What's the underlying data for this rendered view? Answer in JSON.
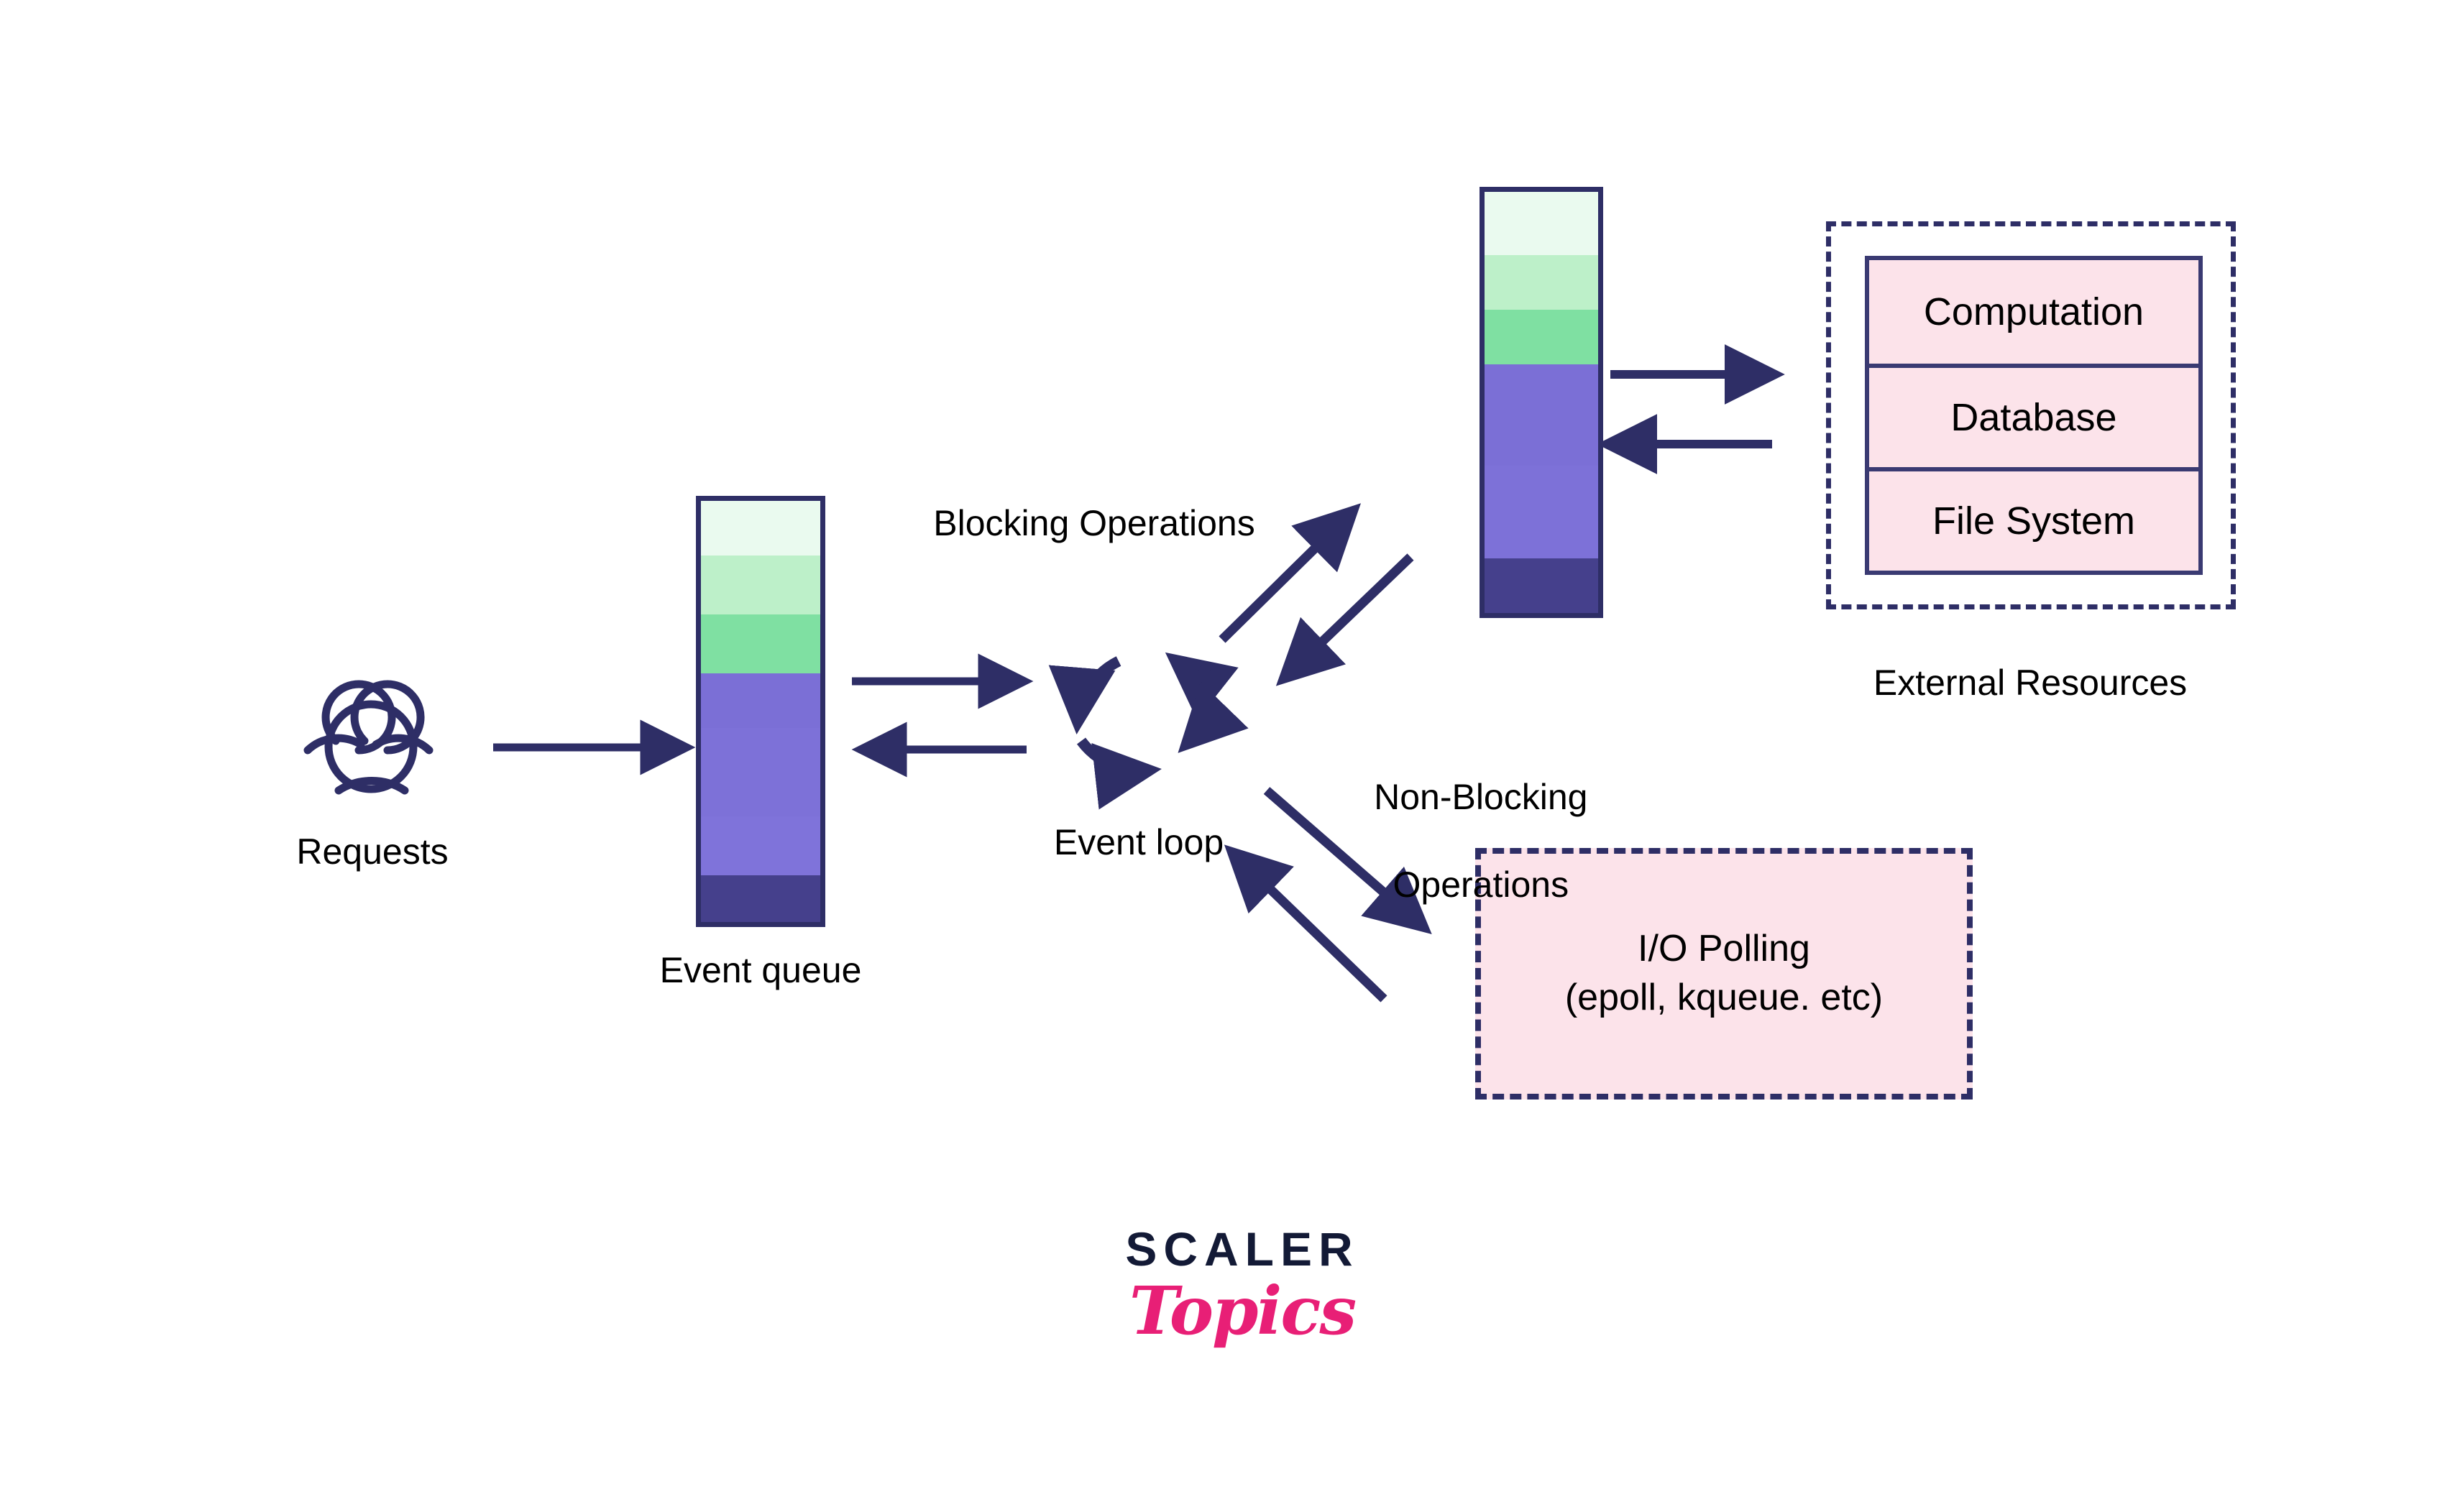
{
  "diagram": {
    "title": "Event loop architecture with event queue, blocking and non-blocking operations",
    "colors": {
      "arrow": "#2e2e66",
      "outline": "#2e2e66",
      "pink_fill": "#fce3ea",
      "pink_border": "#3a3a72",
      "queue_mint": "#eafaef",
      "queue_light_green": "#bdf0c9",
      "queue_green": "#7fe0a2",
      "queue_purple": "#7b6fd6",
      "queue_purple_alt": "#7d71d8",
      "queue_dark": "#45408c",
      "text": "#000000",
      "logo_dark": "#131a36",
      "logo_pink": "#e81f76"
    }
  },
  "requests": {
    "label": "Requests",
    "icon": "users-group-icon"
  },
  "event_queue": {
    "label": "Event queue",
    "segments": [
      {
        "name": "segment-1",
        "color": "#eafaef",
        "height_pct": 13
      },
      {
        "name": "segment-2",
        "color": "#bdf0c9",
        "height_pct": 14
      },
      {
        "name": "segment-3",
        "color": "#7fe0a2",
        "height_pct": 14
      },
      {
        "name": "segment-4",
        "color": "#7b6fd6",
        "height_pct": 13
      },
      {
        "name": "segment-5",
        "color": "#7d71d8",
        "height_pct": 21
      },
      {
        "name": "segment-6",
        "color": "#7f73da",
        "height_pct": 14
      },
      {
        "name": "segment-7",
        "color": "#45408c",
        "height_pct": 11
      }
    ]
  },
  "worker_queue": {
    "segments": [
      {
        "name": "segment-1",
        "color": "#eafaef",
        "height_pct": 15
      },
      {
        "name": "segment-2",
        "color": "#bdf0c9",
        "height_pct": 13
      },
      {
        "name": "segment-3",
        "color": "#7fe0a2",
        "height_pct": 13
      },
      {
        "name": "segment-4",
        "color": "#7b6fd6",
        "height_pct": 24
      },
      {
        "name": "segment-5",
        "color": "#7d71d8",
        "height_pct": 22
      },
      {
        "name": "segment-6",
        "color": "#45408c",
        "height_pct": 13
      }
    ]
  },
  "event_loop": {
    "label": "Event loop",
    "icon": "circular-arrows-icon"
  },
  "operations": {
    "blocking_label": "Blocking Operations",
    "non_blocking_label_line1": "Non-Blocking",
    "non_blocking_label_line2": "Operations"
  },
  "external_resources": {
    "caption": "External Resources",
    "items": [
      "Computation",
      "Database",
      "File System"
    ]
  },
  "io_polling": {
    "line1": "I/O Polling",
    "line2": "(epoll, kqueue. etc)"
  },
  "logo": {
    "top": "SCALER",
    "bottom": "Topics"
  }
}
